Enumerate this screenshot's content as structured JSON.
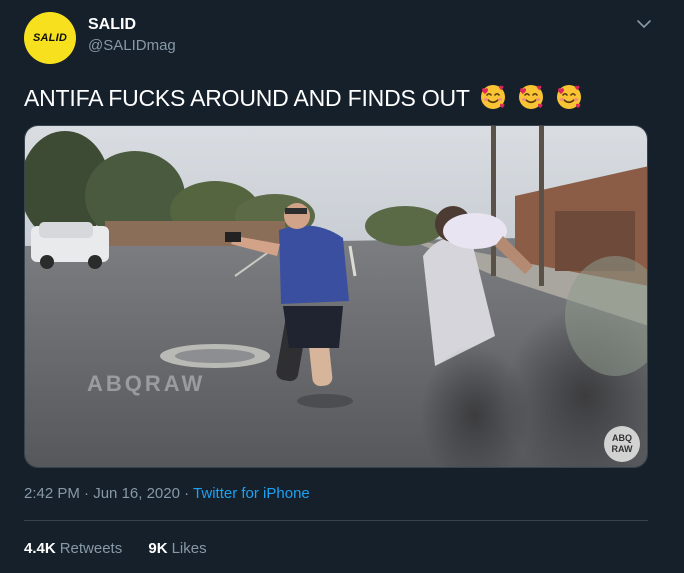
{
  "author": {
    "display_name": "SALID",
    "handle": "@SALIDmag",
    "avatar_text": "SALID"
  },
  "tweet": {
    "text": "ANTIFA FUCKS AROUND AND FINDS OUT",
    "emojis": [
      "smiling-face-with-hearts",
      "smiling-face-with-hearts",
      "smiling-face-with-hearts"
    ]
  },
  "media": {
    "type": "video-frame",
    "watermark": "ABQRAW",
    "corner_logo_line1": "ABQ",
    "corner_logo_line2": "RAW"
  },
  "meta": {
    "time": "2:42 PM",
    "separator": " · ",
    "date": "Jun 16, 2020",
    "source": "Twitter for iPhone"
  },
  "stats": {
    "retweets_count": "4.4K",
    "retweets_label": "Retweets",
    "likes_count": "9K",
    "likes_label": "Likes"
  },
  "colors": {
    "background": "#15202b",
    "text": "#ffffff",
    "secondary": "#8899a6",
    "link": "#1da1f2",
    "border": "#38444d",
    "avatar": "#f7e11e"
  }
}
